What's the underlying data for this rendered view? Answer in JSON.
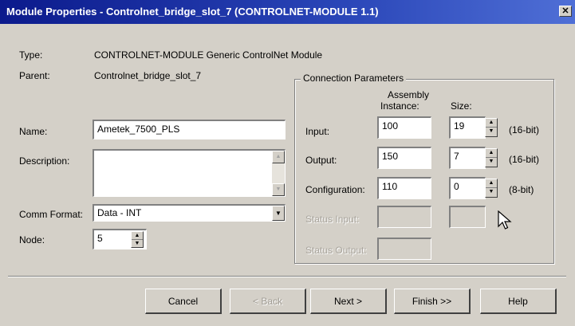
{
  "window": {
    "title": "Module Properties - Controlnet_bridge_slot_7 (CONTROLNET-MODULE 1.1)",
    "close_glyph": "✕"
  },
  "info": {
    "type_label": "Type:",
    "type_value": "CONTROLNET-MODULE Generic ControlNet Module",
    "parent_label": "Parent:",
    "parent_value": "Controlnet_bridge_slot_7"
  },
  "form": {
    "name_label": "Name:",
    "name_value": "Ametek_7500_PLS",
    "description_label": "Description:",
    "description_value": "",
    "comm_format_label": "Comm Format:",
    "comm_format_value": "Data - INT",
    "node_label": "Node:",
    "node_value": "5"
  },
  "connection": {
    "group_title": "Connection Parameters",
    "assembly_header_line1": "Assembly",
    "assembly_header_line2": "Instance:",
    "size_header": "Size:",
    "rows": [
      {
        "label": "Input:",
        "instance": "100",
        "size": "19",
        "unit": "(16-bit)"
      },
      {
        "label": "Output:",
        "instance": "150",
        "size": "7",
        "unit": "(16-bit)"
      },
      {
        "label": "Configuration:",
        "instance": "110",
        "size": "0",
        "unit": "(8-bit)"
      }
    ],
    "status_input_label": "Status Input:",
    "status_output_label": "Status Output:"
  },
  "buttons": {
    "cancel": "Cancel",
    "back": "< Back",
    "next": "Next >",
    "finish": "Finish >>",
    "help": "Help"
  }
}
